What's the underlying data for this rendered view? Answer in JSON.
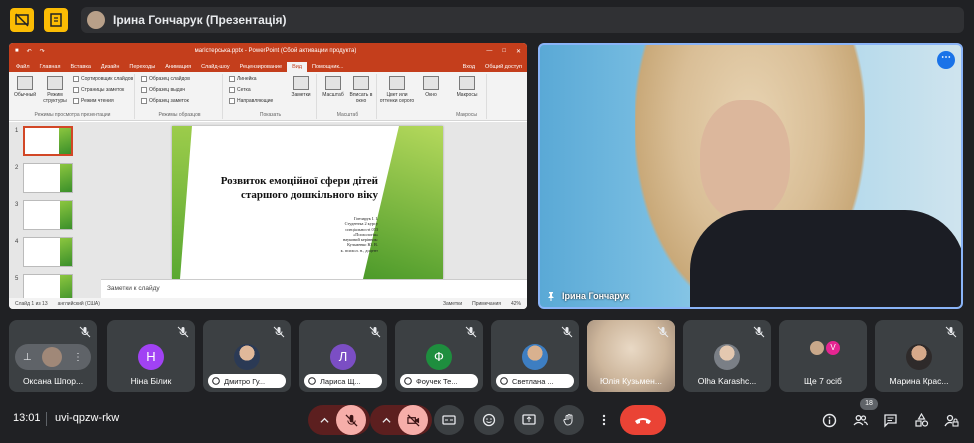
{
  "presenter_bar": {
    "text": "Ірина Гончарук (Презентація)"
  },
  "powerpoint": {
    "title": "магістерська.pptx - PowerPoint (Сбой активации продукта)",
    "tabs": [
      "Файл",
      "Главная",
      "Вставка",
      "Дизайн",
      "Переходы",
      "Анимация",
      "Слайд-шоу",
      "Рецензирование",
      "Вид",
      "Помощник...",
      "Вход",
      "Общий доступ"
    ],
    "ribbon": {
      "normal": "Обычный",
      "structure_mode": "Режим структуры",
      "sorter": "Сортировщик слайдов",
      "notes_page": "Страницы заметок",
      "reading": "Режим чтения",
      "group_views": "Режимы просмотра презентации",
      "slide_master": "Образец слайдов",
      "handout_master": "Образец выдач",
      "notes_master": "Образец заметок",
      "group_masters": "Режимы образцов",
      "ruler": "Линейка",
      "grid": "Сетка",
      "guides": "Направляющие",
      "group_show": "Показать",
      "notes_btn": "Заметки",
      "zoom": "Масштаб",
      "fit": "Вписать в окно",
      "group_zoom": "Масштаб",
      "color": "Цвет или оттенки серого",
      "window": "Окно",
      "macros": "Макросы",
      "group_macros": "Макросы"
    },
    "thumbnails": [
      "1",
      "2",
      "3",
      "4",
      "5"
    ],
    "slide": {
      "title": "Розвиток емоційної сфери дітей старшого дошкільного віку",
      "meta_lines": [
        "Гончарук І. І.",
        "Студентка 2 курсу",
        "спеціальності 053",
        "«Психологія»",
        "науковий керівник:",
        "Кузьменко Ю. В.",
        "к. психол. н., доцент"
      ]
    },
    "notes_placeholder": "Заметки к слайду",
    "status": {
      "slide_of": "Слайд 1 из 13",
      "lang": "английский (США)",
      "notes": "Заметки",
      "comments": "Примечания",
      "zoom": "42%"
    }
  },
  "main_video": {
    "name": "Ірина Гончарук"
  },
  "tiles": [
    {
      "name": "Оксана Шпор..."
    },
    {
      "name": "Ніна Білик",
      "letter": "Н",
      "color": "#a142f4"
    },
    {
      "name": "Дмитро Гу..."
    },
    {
      "name": "Лариса Щ...",
      "letter": "Л",
      "color": "#7b4ec4"
    },
    {
      "name": "Фоучек Те...",
      "letter": "Ф",
      "color": "#1e8e3e"
    },
    {
      "name": "Светлана ..."
    },
    {
      "name": "Юлія Кузьмен..."
    },
    {
      "name": "Olha Karashc..."
    },
    {
      "name": "Ще 7 осіб",
      "letter": "V",
      "color": "#e52592"
    },
    {
      "name": "Марина Крас..."
    }
  ],
  "bottom": {
    "time": "13:01",
    "meeting_code": "uvi-qpzw-rkw",
    "participants_count": "18"
  }
}
